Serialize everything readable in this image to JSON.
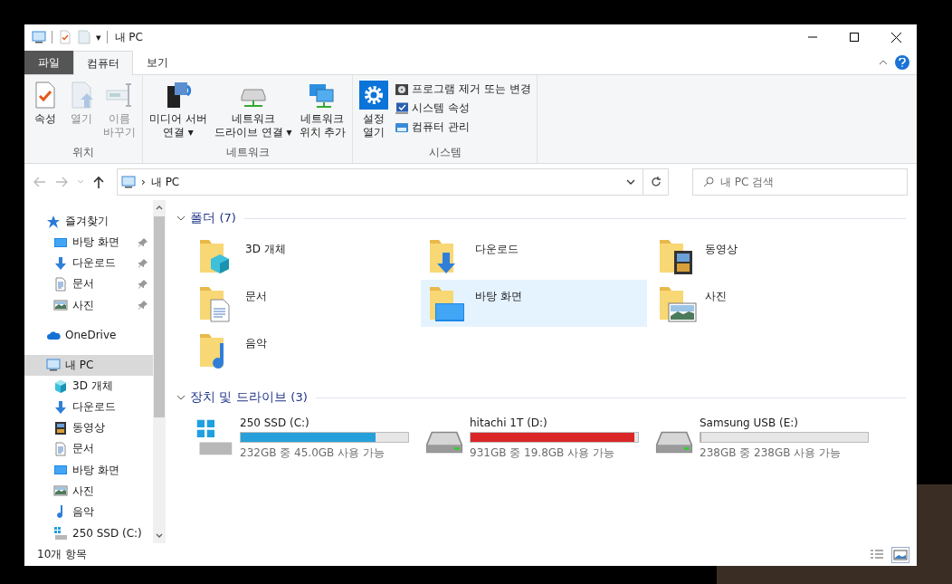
{
  "window": {
    "title": "내 PC"
  },
  "quick_access_toolbar": {
    "dropdown": "▾"
  },
  "ribbon_tabs": [
    {
      "label": "파일",
      "kind": "file",
      "selected": false
    },
    {
      "label": "컴퓨터",
      "kind": "tab",
      "selected": true
    },
    {
      "label": "보기",
      "kind": "tab",
      "selected": false
    }
  ],
  "ribbon_groups": [
    {
      "label": "위치",
      "commands": [
        {
          "kind": "properties",
          "label": "속성",
          "disabled": false
        },
        {
          "kind": "open",
          "label": "열기",
          "disabled": true
        },
        {
          "kind": "rename",
          "label": "이름\n바꾸기",
          "disabled": true
        }
      ]
    },
    {
      "label": "네트워크",
      "commands": [
        {
          "kind": "media",
          "label": "미디어 서버\n연결",
          "dropdown": "▾",
          "disabled": false
        },
        {
          "kind": "netdrive",
          "label": "네트워크\n드라이브 연결",
          "dropdown": "▾",
          "disabled": false
        },
        {
          "kind": "netloc",
          "label": "네트워크\n위치 추가",
          "disabled": false
        }
      ]
    },
    {
      "label": "시스템",
      "commands": [
        {
          "kind": "settings",
          "label": "설정\n열기",
          "disabled": false
        }
      ],
      "small_commands": [
        {
          "kind": "uninstall",
          "label": "프로그램 제거 또는 변경",
          "disabled": false
        },
        {
          "kind": "sysprops",
          "label": "시스템 속성",
          "disabled": false
        },
        {
          "kind": "manage",
          "label": "컴퓨터 관리",
          "disabled": false
        }
      ]
    }
  ],
  "address_bar": {
    "path": "내 PC",
    "separator": "›"
  },
  "search": {
    "placeholder": "내 PC 검색"
  },
  "sidebar": {
    "items": [
      {
        "label": "즐겨찾기",
        "kind": "star",
        "selected": false,
        "children": [
          {
            "label": "바탕 화면",
            "kind": "desktop",
            "pinned": true,
            "selected": false
          },
          {
            "label": "다운로드",
            "kind": "download",
            "pinned": true,
            "selected": false
          },
          {
            "label": "문서",
            "kind": "document",
            "pinned": true,
            "selected": false
          },
          {
            "label": "사진",
            "kind": "picture",
            "pinned": true,
            "selected": false
          }
        ]
      },
      {
        "label": "OneDrive",
        "kind": "cloud",
        "selected": false
      },
      {
        "label": "내 PC",
        "kind": "pc",
        "selected": true,
        "children": [
          {
            "label": "3D 개체",
            "kind": "cube",
            "selected": false
          },
          {
            "label": "다운로드",
            "kind": "download",
            "selected": false
          },
          {
            "label": "동영상",
            "kind": "video",
            "selected": false
          },
          {
            "label": "문서",
            "kind": "document",
            "selected": false
          },
          {
            "label": "바탕 화면",
            "kind": "desktop",
            "selected": false
          },
          {
            "label": "사진",
            "kind": "picture",
            "selected": false
          },
          {
            "label": "음악",
            "kind": "music",
            "selected": false
          },
          {
            "label": "250 SSD (C:)",
            "kind": "windrive",
            "selected": false
          }
        ]
      }
    ]
  },
  "folders": {
    "title": "폴더",
    "count": "(7)",
    "expanded": true,
    "items": [
      {
        "label": "3D 개체",
        "kind": "cube",
        "selected": false
      },
      {
        "label": "다운로드",
        "kind": "download",
        "selected": false
      },
      {
        "label": "동영상",
        "kind": "video",
        "selected": false
      },
      {
        "label": "문서",
        "kind": "document",
        "selected": false
      },
      {
        "label": "바탕 화면",
        "kind": "desktop",
        "selected": true
      },
      {
        "label": "사진",
        "kind": "picture",
        "selected": false
      },
      {
        "label": "음악",
        "kind": "music",
        "selected": false
      }
    ]
  },
  "drives": {
    "title": "장치 및 드라이브",
    "count": "(3)",
    "expanded": true,
    "items": [
      {
        "label": "250 SSD (C:)",
        "kind": "windrive",
        "level": 0.806,
        "color": "#26a0da",
        "free": "232GB 중 45.0GB 사용 가능"
      },
      {
        "label": "hitachi 1T (D:)",
        "kind": "drive",
        "level": 0.979,
        "color": "#da2626",
        "free": "931GB 중 19.8GB 사용 가능"
      },
      {
        "label": "Samsung USB (E:)",
        "kind": "drive",
        "level": 0,
        "free": "238GB 중 238GB 사용 가능"
      }
    ]
  },
  "status_bar": {
    "count": "10개 항목",
    "view_buttons": [
      {
        "kind": "details",
        "selected": false
      },
      {
        "kind": "large",
        "selected": true
      }
    ]
  }
}
